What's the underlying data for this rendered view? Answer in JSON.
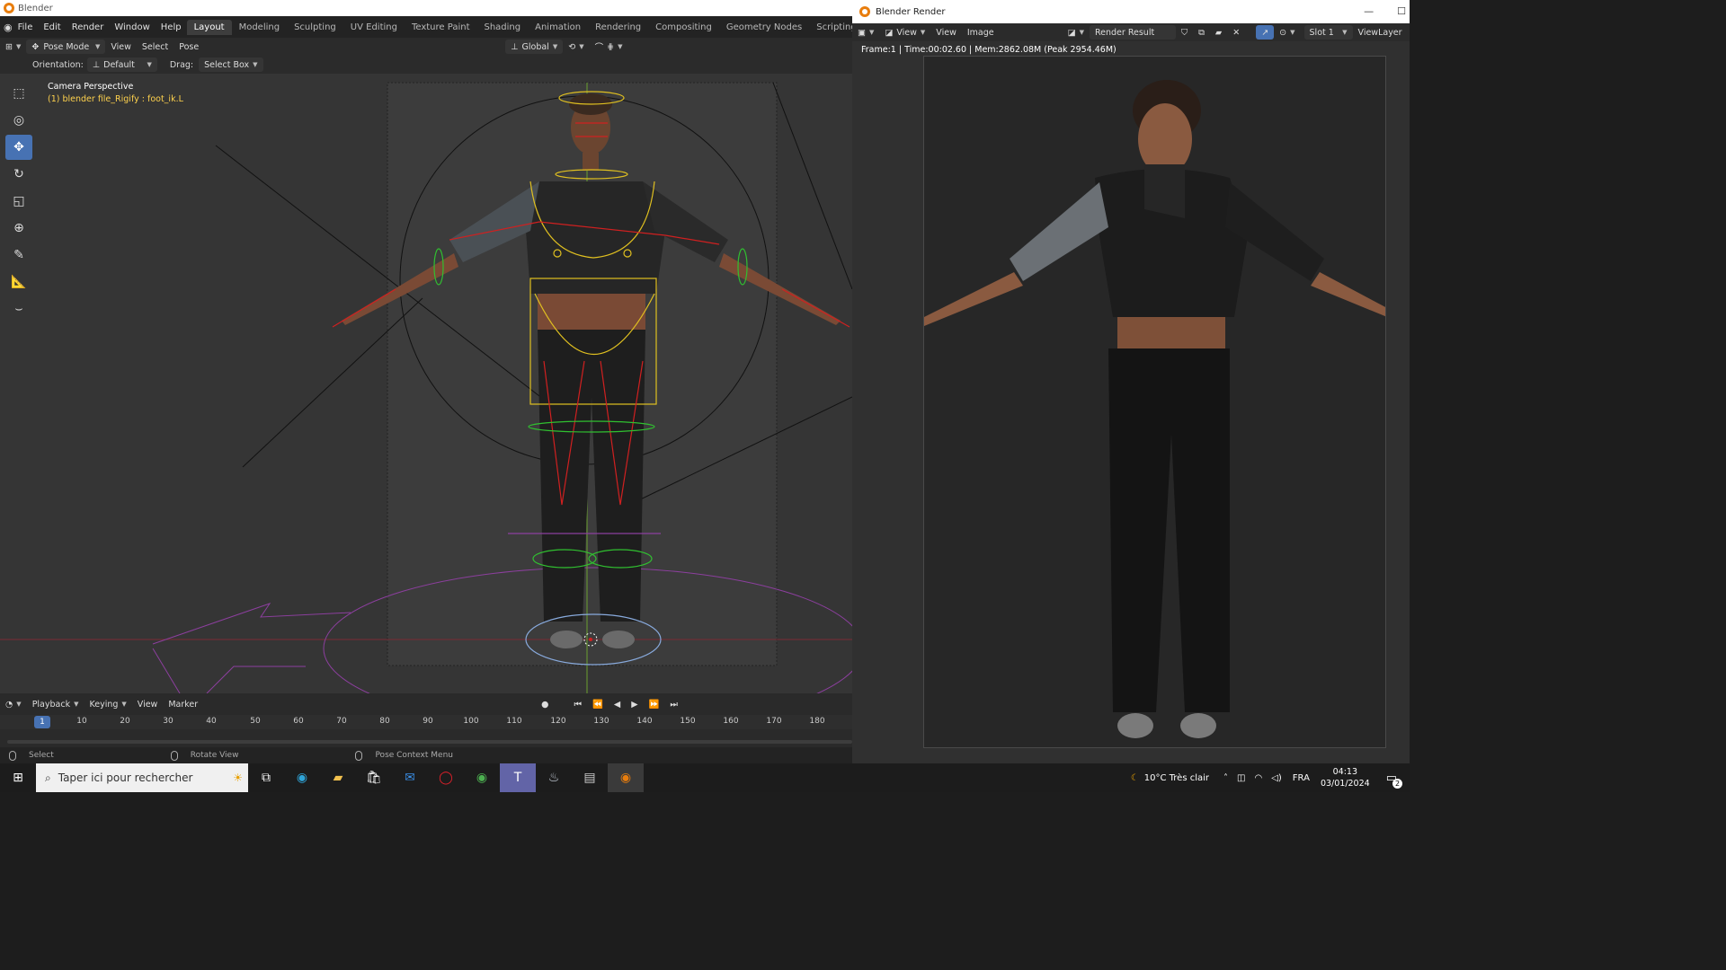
{
  "main_window": {
    "title": "Blender",
    "menu": [
      "File",
      "Edit",
      "Render",
      "Window",
      "Help"
    ],
    "workspaces": [
      "Layout",
      "Modeling",
      "Sculpting",
      "UV Editing",
      "Texture Paint",
      "Shading",
      "Animation",
      "Rendering",
      "Compositing",
      "Geometry Nodes",
      "Scripting"
    ],
    "active_workspace": "Layout",
    "add_workspace": "+",
    "header": {
      "mode": "Pose Mode",
      "view": "View",
      "select": "Select",
      "pose": "Pose",
      "transform_orientation": "Global"
    },
    "toolsettings": {
      "orientation_label": "Orientation:",
      "orientation_value": "Default",
      "drag_label": "Drag:",
      "drag_value": "Select Box"
    },
    "viewport": {
      "camera_label": "Camera Perspective",
      "active_object": "(1) blender file_Rigify : foot_ik.L"
    },
    "timeline": {
      "playback": "Playback",
      "keying": "Keying",
      "view": "View",
      "marker": "Marker",
      "current_frame": "1",
      "ticks": [
        "10",
        "20",
        "30",
        "40",
        "50",
        "60",
        "70",
        "80",
        "90",
        "100",
        "110",
        "120",
        "130",
        "140",
        "150",
        "160",
        "170",
        "180"
      ]
    },
    "statusbar": {
      "left": "Select",
      "middle": "Rotate View",
      "right": "Pose Context Menu"
    }
  },
  "render_window": {
    "title": "Blender Render",
    "view_menu": "View",
    "view": "View",
    "image": "Image",
    "image_name": "Render Result",
    "slot": "Slot 1",
    "view_layer": "ViewLayer",
    "info": "Frame:1 | Time:00:02.60 | Mem:2862.08M (Peak 2954.46M)"
  },
  "taskbar": {
    "search_placeholder": "Taper ici pour rechercher",
    "weather": "10°C  Très clair",
    "language": "FRA",
    "time": "04:13",
    "date": "03/01/2024",
    "notification_count": "2"
  },
  "colors": {
    "accent": "#4772b3",
    "blender_orange": "#e87d0d",
    "active_object_text": "#ffd24d"
  }
}
